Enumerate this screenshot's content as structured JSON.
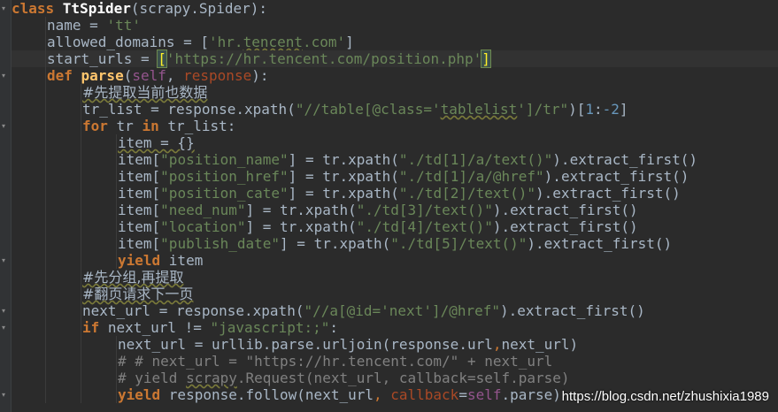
{
  "watermark": "https://blog.csdn.net/zhushixia1989",
  "lines": [
    {
      "indent": 0,
      "tokens": [
        [
          "class ",
          "kw"
        ],
        [
          "TtSpider",
          "cls"
        ],
        [
          "(scrapy.Spider):",
          "p"
        ]
      ]
    },
    {
      "indent": 1,
      "tokens": [
        [
          "name = ",
          "p"
        ],
        [
          "'tt'",
          "str"
        ]
      ]
    },
    {
      "indent": 1,
      "tokens": [
        [
          "allowed_domains = [",
          "p"
        ],
        [
          "'hr.",
          "str"
        ],
        [
          "tencent",
          "str ul"
        ],
        [
          ".com'",
          "str"
        ],
        [
          "]",
          "p"
        ]
      ]
    },
    {
      "indent": 1,
      "current": true,
      "tokens": [
        [
          "start_urls = ",
          "p"
        ],
        [
          "[",
          "mh"
        ],
        [
          "'https://hr.tencent.com/position.php'",
          "str"
        ],
        [
          "]",
          "mh"
        ]
      ]
    },
    {
      "indent": 1,
      "tokens": [
        [
          "def ",
          "kw"
        ],
        [
          "parse",
          "fn"
        ],
        [
          "(",
          "p"
        ],
        [
          "self",
          "slf"
        ],
        [
          ", ",
          "p"
        ],
        [
          "response",
          "par"
        ],
        [
          "):",
          "p"
        ]
      ]
    },
    {
      "indent": 2,
      "tokens": [
        [
          "#先提取当前也数据",
          "cmt ul"
        ]
      ]
    },
    {
      "indent": 2,
      "tokens": [
        [
          "tr_list = response.xpath(",
          "p"
        ],
        [
          "\"//table[@class='",
          "str"
        ],
        [
          "tablelist",
          "str ul"
        ],
        [
          "']/tr\"",
          "str"
        ],
        [
          ")[",
          "p"
        ],
        [
          "1",
          "num"
        ],
        [
          ":",
          "p"
        ],
        [
          "-2",
          "num"
        ],
        [
          "]",
          "p"
        ]
      ]
    },
    {
      "indent": 2,
      "tokens": [
        [
          "for ",
          "kw"
        ],
        [
          "tr ",
          "p"
        ],
        [
          "in ",
          "kw"
        ],
        [
          "tr_list:",
          "p"
        ]
      ]
    },
    {
      "indent": 3,
      "tokens": [
        [
          "item = {}",
          "p ul"
        ]
      ]
    },
    {
      "indent": 3,
      "tokens": [
        [
          "item[",
          "p"
        ],
        [
          "\"position_name\"",
          "str"
        ],
        [
          "] = tr.xpath(",
          "p"
        ],
        [
          "\"./td[1]/a/text()\"",
          "str"
        ],
        [
          ").extract_first()",
          "p"
        ]
      ]
    },
    {
      "indent": 3,
      "tokens": [
        [
          "item[",
          "p"
        ],
        [
          "\"position_href\"",
          "str"
        ],
        [
          "] = tr.xpath(",
          "p"
        ],
        [
          "\"./td[1]/a/@href\"",
          "str"
        ],
        [
          ").extract_first()",
          "p"
        ]
      ]
    },
    {
      "indent": 3,
      "tokens": [
        [
          "item[",
          "p"
        ],
        [
          "\"position_cate\"",
          "str"
        ],
        [
          "] = tr.xpath(",
          "p"
        ],
        [
          "\"./td[2]/text()\"",
          "str"
        ],
        [
          ").extract_first()",
          "p"
        ]
      ]
    },
    {
      "indent": 3,
      "tokens": [
        [
          "item[",
          "p"
        ],
        [
          "\"need_num\"",
          "str"
        ],
        [
          "] = tr.xpath(",
          "p"
        ],
        [
          "\"./td[3]/text()\"",
          "str"
        ],
        [
          ").extract_first()",
          "p"
        ]
      ]
    },
    {
      "indent": 3,
      "tokens": [
        [
          "item[",
          "p"
        ],
        [
          "\"location\"",
          "str"
        ],
        [
          "] = tr.xpath(",
          "p"
        ],
        [
          "\"./td[4]/text()\"",
          "str"
        ],
        [
          ").extract_first()",
          "p"
        ]
      ]
    },
    {
      "indent": 3,
      "tokens": [
        [
          "item[",
          "p"
        ],
        [
          "\"publish_date\"",
          "str"
        ],
        [
          "] = tr.xpath(",
          "p"
        ],
        [
          "\"./td[5]/text()\"",
          "str"
        ],
        [
          ").extract_first()",
          "p"
        ]
      ]
    },
    {
      "indent": 3,
      "tokens": [
        [
          "yield ",
          "kw"
        ],
        [
          "item",
          "p"
        ]
      ]
    },
    {
      "indent": 2,
      "tokens": [
        [
          "#先分组,再提取",
          "cmt ul"
        ]
      ]
    },
    {
      "indent": 2,
      "tokens": [
        [
          "#翻页请求下一页",
          "cmt ul"
        ]
      ]
    },
    {
      "indent": 2,
      "tokens": [
        [
          "next_url = response.xpath(",
          "p"
        ],
        [
          "\"//a[@id='next']/@href\"",
          "str"
        ],
        [
          ").extract_first()",
          "p"
        ]
      ]
    },
    {
      "indent": 2,
      "tokens": [
        [
          "if ",
          "kw"
        ],
        [
          "next_url != ",
          "p"
        ],
        [
          "\"javascript:;\"",
          "str"
        ],
        [
          ":",
          "p"
        ]
      ]
    },
    {
      "indent": 3,
      "tokens": [
        [
          "next_url = urllib.parse.urljoin(response.url",
          "p"
        ],
        [
          ",",
          "kwn"
        ],
        [
          "next_url)",
          "p"
        ]
      ]
    },
    {
      "indent": 3,
      "tokens": [
        [
          "# # next_url = \"https://hr.tencent.com/\" + next_url",
          "cmt"
        ]
      ]
    },
    {
      "indent": 3,
      "tokens": [
        [
          "# yield ",
          "cmt"
        ],
        [
          "scrapy",
          "cmt ul"
        ],
        [
          ".Request(next_url, callback=self.parse)",
          "cmt"
        ]
      ]
    },
    {
      "indent": 3,
      "tokens": [
        [
          "yield ",
          "kw"
        ],
        [
          "response.follow(next_url",
          "p"
        ],
        [
          ", ",
          "kwn"
        ],
        [
          "callback",
          "kwarg"
        ],
        [
          "=",
          "p"
        ],
        [
          "self",
          "slf"
        ],
        [
          ".parse)",
          "p"
        ]
      ]
    }
  ]
}
